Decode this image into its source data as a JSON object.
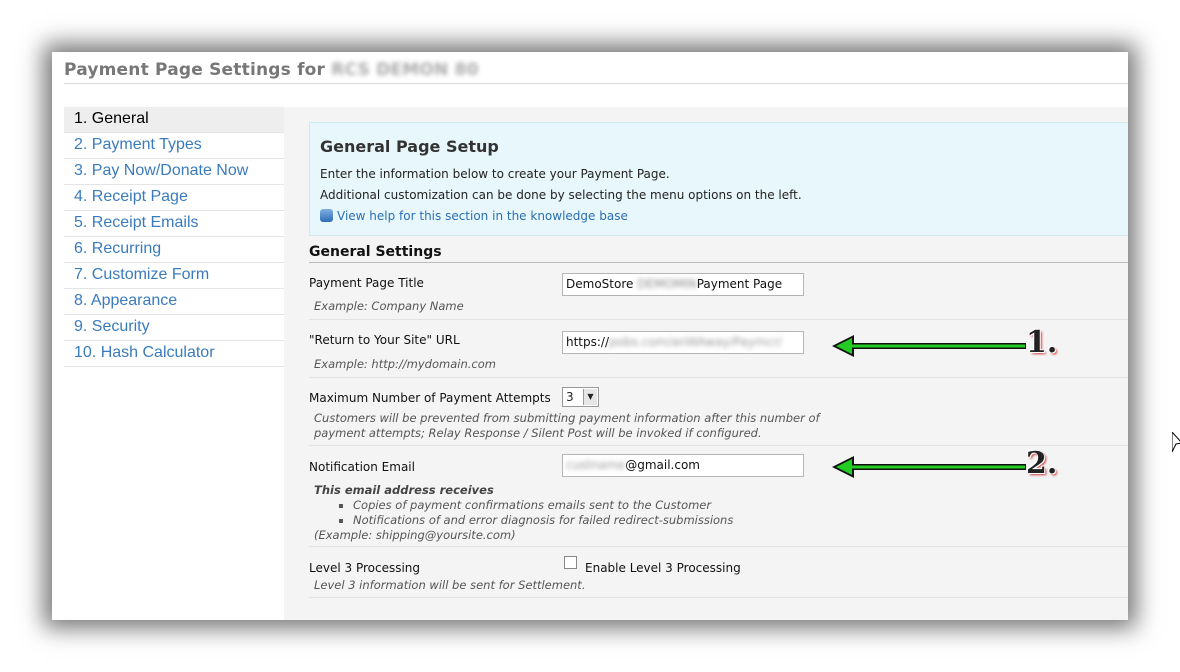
{
  "header": {
    "title": "Payment Page Settings for",
    "account_blurred": "RCS DEMON 80"
  },
  "sidebar": {
    "items": [
      {
        "label": "1. General",
        "active": true
      },
      {
        "label": "2. Payment Types"
      },
      {
        "label": "3. Pay Now/Donate Now"
      },
      {
        "label": "4. Receipt Page"
      },
      {
        "label": "5. Receipt Emails"
      },
      {
        "label": "6. Recurring"
      },
      {
        "label": "7. Customize Form"
      },
      {
        "label": "8. Appearance"
      },
      {
        "label": "9. Security"
      },
      {
        "label": "10. Hash Calculator"
      }
    ]
  },
  "setup": {
    "title": "General Page Setup",
    "line1": "Enter the information below to create your Payment Page.",
    "line2": "Additional customization can be done by selecting the menu options on the left.",
    "help_link": "View help for this section in the knowledge base"
  },
  "settings": {
    "title": "General Settings",
    "page_title": {
      "label": "Payment Page Title",
      "value_pre": "DemoStore",
      "value_blur": "DEMOMIN",
      "value_post": "Payment Page",
      "example": "Example: Company Name"
    },
    "return_url": {
      "label": "\"Return to Your Site\" URL",
      "value_pre": "https://",
      "value_blur": "pobs.com/anWAway/Paymcr/",
      "example": "Example: http://mydomain.com"
    },
    "max_attempts": {
      "label": "Maximum Number of Payment Attempts",
      "value": "3",
      "hint1": "Customers will be prevented from submitting payment information after this number of",
      "hint2": "payment attempts; Relay Response / Silent Post will be invoked if configured."
    },
    "notification_email": {
      "label": "Notification Email",
      "value_blur": "custname",
      "value_post": "@gmail.com",
      "hint_heading": "This email address receives",
      "bullets": [
        "Copies of payment confirmations emails sent to the Customer",
        "Notifications of and error diagnosis for failed redirect-submissions"
      ],
      "example": "(Example: shipping@yoursite.com)"
    },
    "level3": {
      "label": "Level 3 Processing",
      "checkbox_label": "Enable Level 3 Processing",
      "hint": "Level 3 information will be sent for Settlement."
    }
  },
  "annotations": {
    "arrow1": "1.",
    "arrow2": "2.",
    "arrow_color": "#22cc22"
  }
}
